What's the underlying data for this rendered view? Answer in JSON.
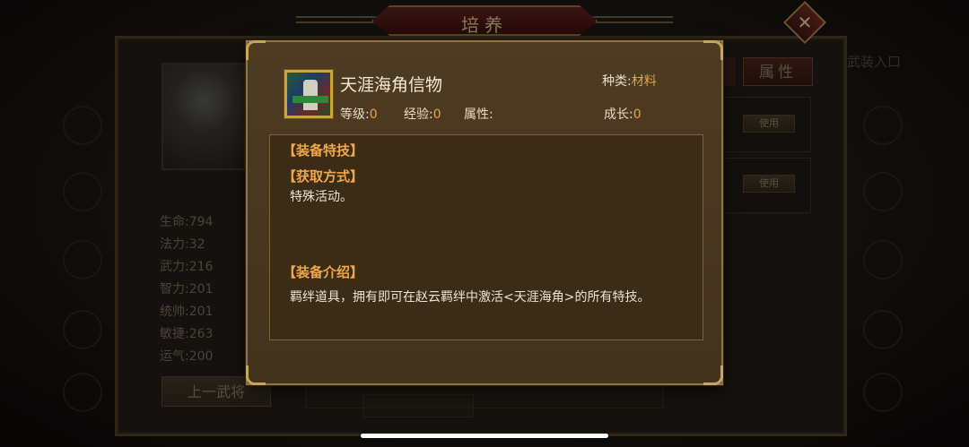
{
  "header": {
    "title": "培养"
  },
  "close_glyph": "✕",
  "background": {
    "stats": [
      {
        "label": "生命",
        "value": "794"
      },
      {
        "label": "法力",
        "value": "32"
      },
      {
        "label": "武力",
        "value": "216"
      },
      {
        "label": "智力",
        "value": "201"
      },
      {
        "label": "统帅",
        "value": "201"
      },
      {
        "label": "敏捷",
        "value": "263"
      },
      {
        "label": "运气",
        "value": "200"
      }
    ],
    "prev_general_label": "上一武将",
    "attr_tab_label": "属性",
    "use_label": "使用",
    "right_text": "武装入口"
  },
  "modal": {
    "item_name": "天涯海角信物",
    "kind_label": "种类:",
    "kind_value": "材料",
    "level_label": "等级:",
    "level_value": "0",
    "exp_label": "经验:",
    "exp_value": "0",
    "attr_label": "属性:",
    "growth_label": "成长:",
    "growth_value": "0",
    "sections": {
      "skill_title": "【装备特技】",
      "obtain_title": "【获取方式】",
      "obtain_body": "特殊活动。",
      "intro_title": "【装备介绍】",
      "intro_body": "羁绊道具，拥有即可在赵云羁绊中激活<天涯海角>的所有特技。"
    }
  },
  "colors": {
    "accent": "#e0a64a",
    "section_title": "#f0a64c",
    "frame": "#8f7544"
  }
}
